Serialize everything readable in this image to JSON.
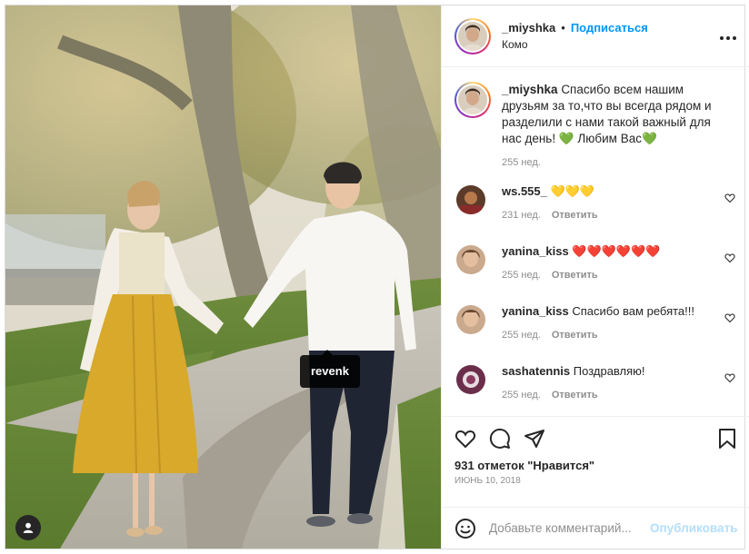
{
  "post": {
    "username": "_miyshka",
    "dot": "•",
    "follow_label": "Подписаться",
    "location": "Комо",
    "photo_tag": "revenk"
  },
  "caption": {
    "username": "_miyshka",
    "text": "Спасибо всем нашим друзьям за то,что вы всегда рядом и разделили с нами такой важный для нас день! 💚 Любим Вас💚",
    "time": "255 нед."
  },
  "comments": [
    {
      "username": "ws.555_",
      "text": "💛💛💛",
      "time": "231 нед.",
      "reply": "Ответить"
    },
    {
      "username": "yanina_kiss",
      "text": "❤️❤️❤️❤️❤️❤️",
      "time": "255 нед.",
      "reply": "Ответить"
    },
    {
      "username": "yanina_kiss",
      "text": "Спасибо вам ребята!!!",
      "time": "255 нед.",
      "reply": "Ответить"
    },
    {
      "username": "sashatennis",
      "text": "Поздравляю!",
      "time": "255 нед.",
      "reply": "Ответить"
    }
  ],
  "actions": {
    "likes": "931 отметок \"Нравится\"",
    "date": "ИЮНЬ 10, 2018"
  },
  "add_comment": {
    "placeholder": "Добавьте комментарий...",
    "post_label": "Опубликовать"
  },
  "colors": {
    "link_blue": "#0095f6",
    "muted": "#8e8e8e",
    "disabled_blue": "#b2dffc"
  },
  "icons": [
    "more-icon",
    "heart-icon",
    "comment-icon",
    "share-icon",
    "bookmark-icon",
    "emoji-icon",
    "user-tag-icon",
    "small-heart-icon"
  ]
}
